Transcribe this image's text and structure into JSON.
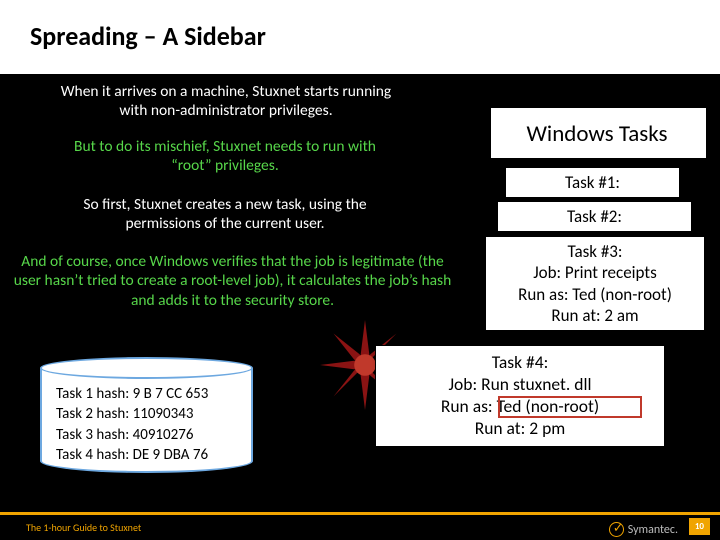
{
  "title": "Spreading – A Sidebar",
  "para1": "When it arrives on a machine, Stuxnet starts running with non-administrator privileges.",
  "para2": "But to do its mischief, Stuxnet needs to run with “root” privileges.",
  "para3": "So first, Stuxnet creates a new task, using the permissions of the current user.",
  "para4": "And of course, once Windows verifies that the job is legitimate (the user hasn’t tried to create a root-level job), it calculates the job’s hash and adds it to the security store.",
  "tasks_header": "Windows Tasks",
  "task1": {
    "title": "Task #1:"
  },
  "task2": {
    "title": "Task #2:"
  },
  "task3": {
    "title": "Task #3:",
    "job": "Job: Print receipts",
    "runas": "Run as: Ted (non-root)",
    "runat": "Run at: 2 am"
  },
  "task4": {
    "title": "Task #4:",
    "job": "Job: Run stuxnet. dll",
    "runas_label": "Run as: ",
    "runas_value": "Ted (non-root)",
    "runat": "Run at: 2 pm"
  },
  "hashes": {
    "h1": "Task 1 hash: 9 B 7 CC 653",
    "h2": "Task 2 hash: 11090343",
    "h3": "Task 3 hash: 40910276",
    "h4": "Task 4 hash: DE 9 DBA 76"
  },
  "footer_left": "The 1-hour Guide to Stuxnet",
  "footer_brand": "Symantec.",
  "page_number": "10"
}
